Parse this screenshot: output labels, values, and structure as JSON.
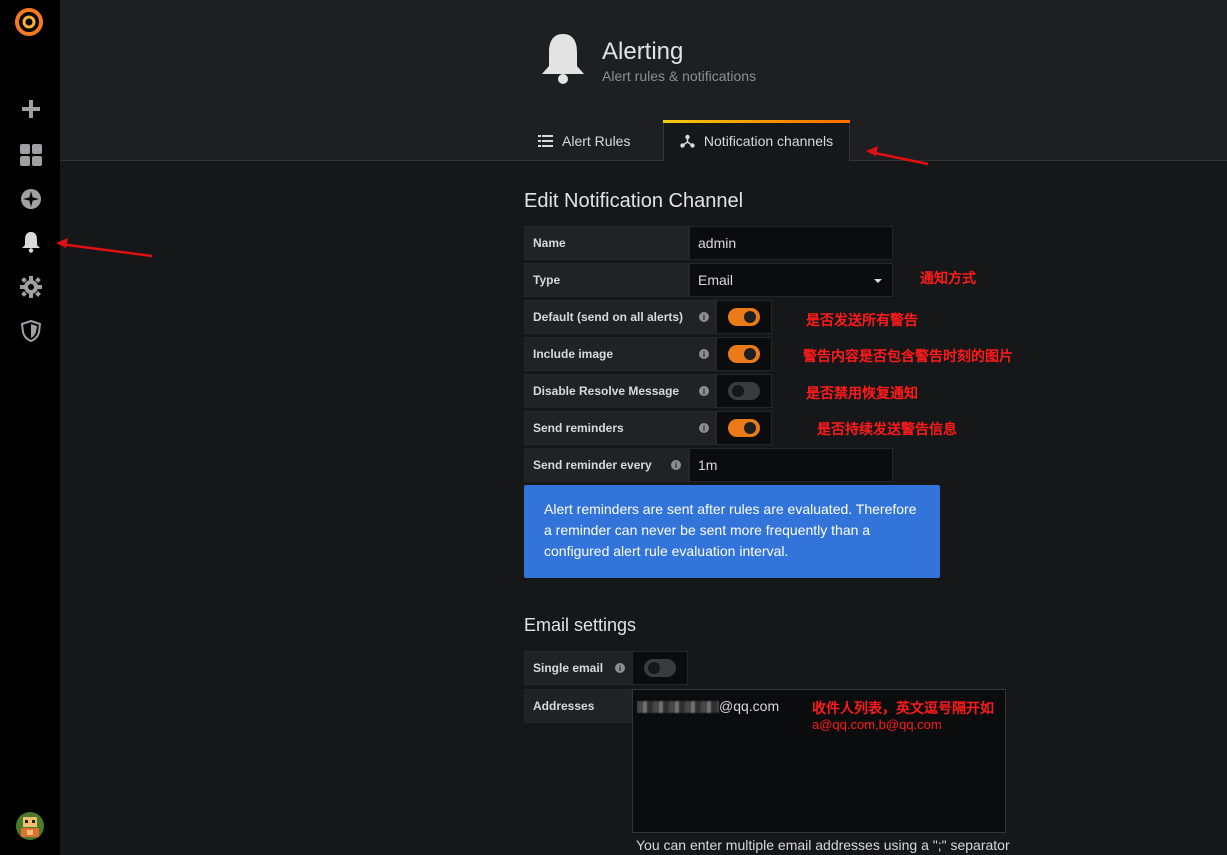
{
  "header": {
    "title": "Alerting",
    "subtitle": "Alert rules & notifications"
  },
  "tabs": [
    {
      "label": "Alert Rules",
      "active": false
    },
    {
      "label": "Notification channels",
      "active": true
    }
  ],
  "form": {
    "title": "Edit Notification Channel",
    "name": {
      "label": "Name",
      "value": "admin"
    },
    "type": {
      "label": "Type",
      "value": "Email"
    },
    "toggles": [
      {
        "label": "Default (send on all alerts)",
        "on": true
      },
      {
        "label": "Include image",
        "on": true
      },
      {
        "label": "Disable Resolve Message",
        "on": false
      },
      {
        "label": "Send reminders",
        "on": true
      }
    ],
    "reminder_every": {
      "label": "Send reminder every",
      "value": "1m"
    },
    "alert_info": "Alert reminders are sent after rules are evaluated. Therefore a reminder can never be sent more frequently than a configured alert rule evaluation interval."
  },
  "email": {
    "title": "Email settings",
    "single_email": {
      "label": "Single email",
      "on": false
    },
    "addresses": {
      "label": "Addresses",
      "value_suffix": "@qq.com"
    },
    "help": "You can enter multiple email addresses using a \";\" separator"
  },
  "annotations": {
    "type_note": "通知方式",
    "default_note": "是否发送所有警告",
    "image_note": "警告内容是否包含警告时刻的图片",
    "resolve_note": "是否禁用恢复通知",
    "reminders_note": "是否持续发送警告信息",
    "addresses_note": "收件人列表，英文逗号隔开如",
    "addresses_example": "a@qq.com,b@qq.com"
  },
  "colors": {
    "accent": "#eb7b18",
    "info": "#3274d9",
    "annotation": "#ff1a1a"
  }
}
